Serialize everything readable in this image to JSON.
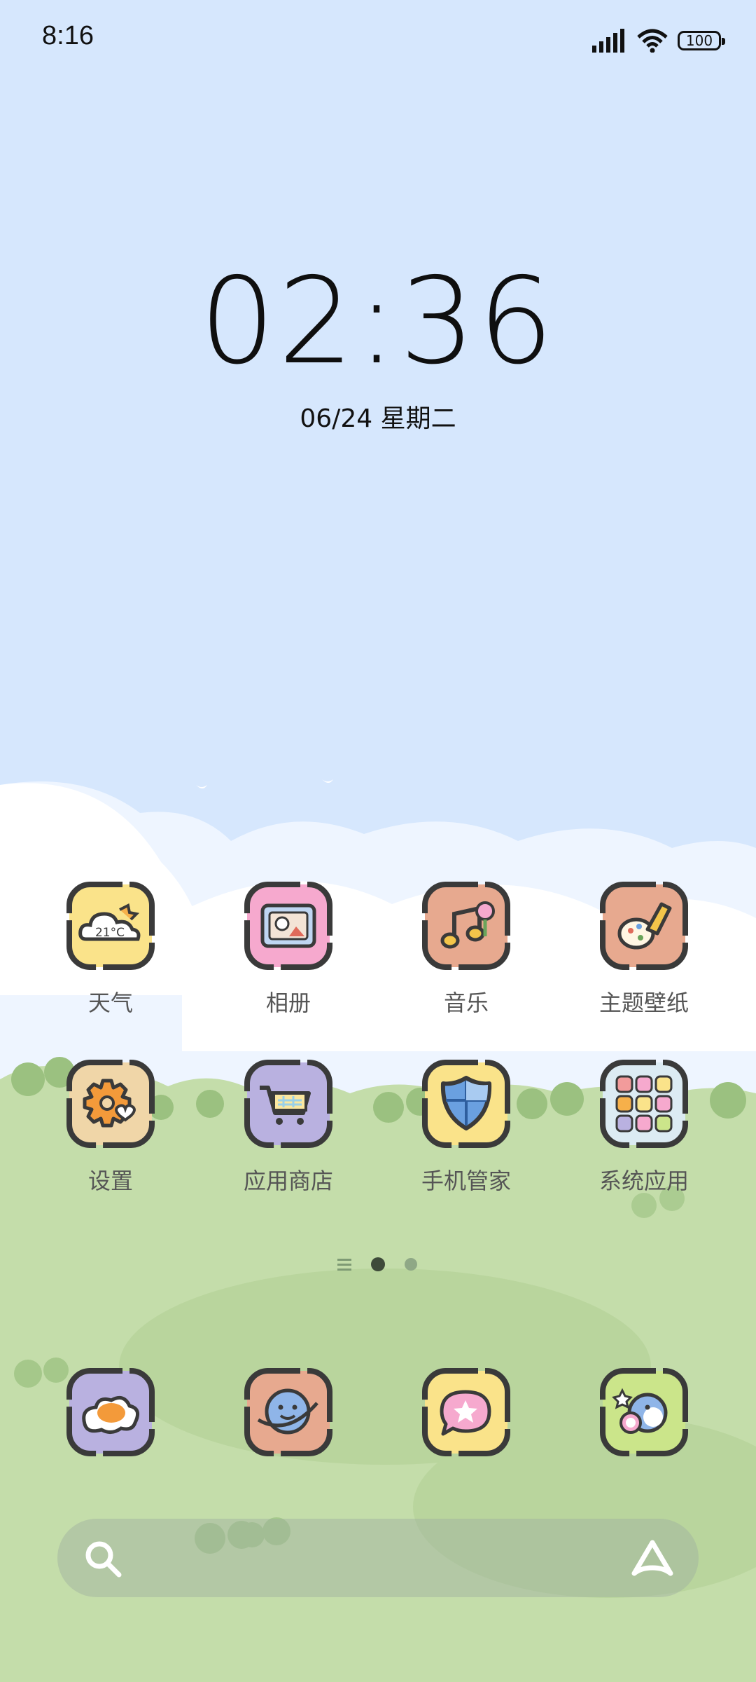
{
  "status_bar": {
    "time": "8:16",
    "battery": "100"
  },
  "clock": {
    "time": "02:36",
    "date": "06/24 星期二"
  },
  "apps": [
    {
      "label": "天气",
      "icon": "weather-icon",
      "badge": "21°C",
      "bg": "#FAE38A"
    },
    {
      "label": "相册",
      "icon": "gallery-icon",
      "bg": "#F6A9CE"
    },
    {
      "label": "音乐",
      "icon": "music-icon",
      "bg": "#E7A98F"
    },
    {
      "label": "主题壁纸",
      "icon": "theme-wallpaper-icon",
      "bg": "#E7A98F"
    },
    {
      "label": "设置",
      "icon": "settings-icon",
      "bg": "#F0D6A8"
    },
    {
      "label": "应用商店",
      "icon": "app-store-icon",
      "bg": "#B9B1E0"
    },
    {
      "label": "手机管家",
      "icon": "security-icon",
      "bg": "#FAE38A"
    },
    {
      "label": "系统应用",
      "icon": "system-apps-folder-icon",
      "bg": "#DCEBF3"
    }
  ],
  "dock": [
    {
      "icon": "egg-dock-icon",
      "bg": "#B9B1E0"
    },
    {
      "icon": "planet-dock-icon",
      "bg": "#E7A98F"
    },
    {
      "icon": "star-bubble-dock-icon",
      "bg": "#FAE38A"
    },
    {
      "icon": "penguin-dock-icon",
      "bg": "#CBE58A"
    }
  ],
  "page_indicator": {
    "pages": 2,
    "current": 1
  },
  "colors": {
    "sky": "#D6E7FD",
    "grass": "#C4DDAA",
    "outline": "#3A3A3A"
  }
}
